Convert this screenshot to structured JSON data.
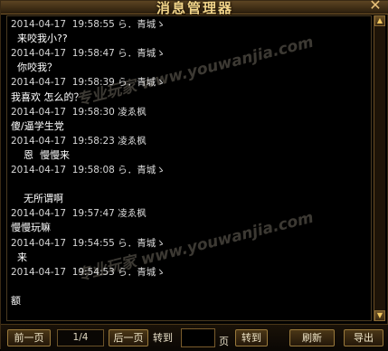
{
  "window": {
    "title": "消息管理器",
    "close_label": "✕"
  },
  "messages": [
    {
      "kind": "stamp",
      "text": "2014-04-17  19:58:55 ら．青城ゝ"
    },
    {
      "kind": "msg",
      "text": "  来咬我小??"
    },
    {
      "kind": "stamp",
      "text": "2014-04-17  19:58:47 ら．青城ゝ"
    },
    {
      "kind": "msg",
      "text": "  你咬我？"
    },
    {
      "kind": "stamp",
      "text": "2014-04-17  19:58:39 ら．青城ゝ"
    },
    {
      "kind": "msg",
      "text": "我喜欢 怎么的？"
    },
    {
      "kind": "stamp",
      "text": "2014-04-17  19:58:30 凌ゑ枫"
    },
    {
      "kind": "msg",
      "text": "傻/逼学生党"
    },
    {
      "kind": "stamp",
      "text": "2014-04-17  19:58:23 凌ゑ枫"
    },
    {
      "kind": "msg",
      "text": "    恩  慢慢来"
    },
    {
      "kind": "stamp",
      "text": "2014-04-17  19:58:08 ら．青城ゝ"
    },
    {
      "kind": "msg",
      "text": ""
    },
    {
      "kind": "msg",
      "text": "    无所谓啊"
    },
    {
      "kind": "stamp",
      "text": "2014-04-17  19:57:47 凌ゑ枫"
    },
    {
      "kind": "msg",
      "text": "慢慢玩嘛"
    },
    {
      "kind": "stamp",
      "text": "2014-04-17  19:54:55 ら．青城ゝ"
    },
    {
      "kind": "msg",
      "text": "  来"
    },
    {
      "kind": "stamp",
      "text": "2014-04-17  19:54:53 ら．青城ゝ"
    },
    {
      "kind": "msg",
      "text": ""
    },
    {
      "kind": "msg",
      "text": "额"
    }
  ],
  "watermarks": [
    "专业玩家 ",
    "www.youwanjia.com"
  ],
  "toolbar": {
    "prev_label": "前一页",
    "page_indicator": "1/4",
    "next_label": "后一页",
    "goto_label": "转到",
    "page_input_value": "",
    "page_unit": "页",
    "goto_button": "转到",
    "refresh_button": "刷新",
    "export_button": "导出"
  }
}
